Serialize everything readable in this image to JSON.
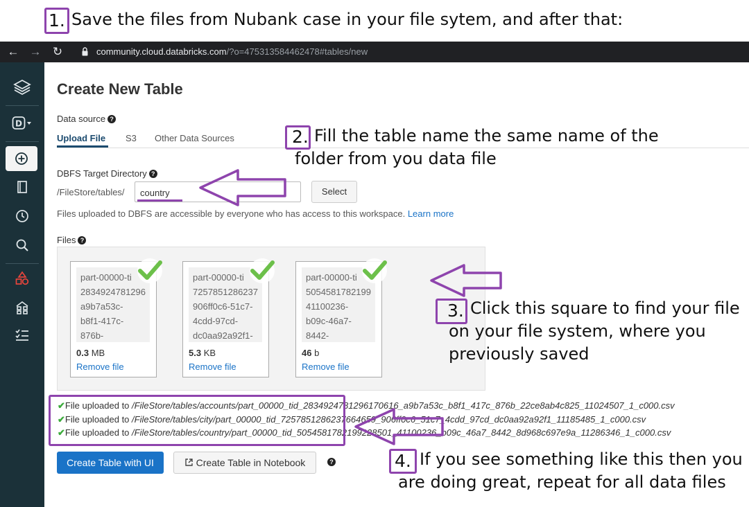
{
  "annotations": {
    "step1": {
      "num": "1.",
      "text": "Save the files from Nubank case in your file sytem, and after that:"
    },
    "step2": {
      "num": "2.",
      "line1": "Fill the table name the same name of the",
      "line2": "folder from you data file"
    },
    "step3": {
      "num": "3.",
      "line1": "Click this square to find your file",
      "line2": "on your file system, where you",
      "line3": "previously saved"
    },
    "step4": {
      "num": "4.",
      "line1": "If you see something like this then you",
      "line2": "are doing great, repeat for all data files"
    },
    "color": "#8e44ad"
  },
  "browser": {
    "url_host": "community.cloud.databricks.com",
    "url_rest": "/?o=475313584462478#tables/new"
  },
  "page": {
    "title": "Create New Table",
    "data_source_label": "Data source",
    "tabs": [
      "Upload File",
      "S3",
      "Other Data Sources"
    ],
    "dbfs_label": "DBFS Target Directory",
    "dbfs_prefix": "/FileStore/tables/",
    "dbfs_value": "country",
    "select_button": "Select",
    "access_note": "Files uploaded to DBFS are accessible by everyone who has access to this workspace.",
    "learn_more": "Learn more",
    "files_label": "Files"
  },
  "files": [
    {
      "lines": [
        "part-00000-ti",
        "2834924781296",
        "a9b7a53c-",
        "b8f1-417c-",
        "876b-"
      ],
      "size_num": "0.3",
      "size_unit": "MB",
      "remove": "Remove file"
    },
    {
      "lines": [
        "part-00000-ti",
        "7257851286237",
        "906ff0c6-51c7-",
        "4cdd-97cd-",
        "dc0aa92a92f1-"
      ],
      "size_num": "5.3",
      "size_unit": "KB",
      "remove": "Remove file"
    },
    {
      "lines": [
        "part-00000-ti",
        "5054581782199",
        "41100236-",
        "b09c-46a7-",
        "8442-"
      ],
      "size_num": "46",
      "size_unit": "b",
      "remove": "Remove file"
    }
  ],
  "uploaded": [
    {
      "prefix": "File uploaded to ",
      "path": "/FileStore/tables/accounts/part_00000_tid_2834924781296170616_a9b7a53c_b8f1_417c_876b_22ce8ab4c825_11024507_1_c000.csv"
    },
    {
      "prefix": "File uploaded to ",
      "path": "/FileStore/tables/city/part_00000_tid_7257851286237664659_906ff0c6_51c7_4cdd_97cd_dc0aa92a92f1_11185485_1_c000.csv"
    },
    {
      "prefix": "File uploaded to ",
      "path": "/FileStore/tables/country/part_00000_tid_5054581782199228501_41100236_b09c_46a7_8442_8d968c697e9a_11286346_1_c000.csv"
    }
  ],
  "buttons": {
    "create_ui": "Create Table with UI",
    "create_notebook": "Create Table in Notebook"
  },
  "icons": [
    "back-icon",
    "forward-icon",
    "reload-icon",
    "lock-icon",
    "databricks-logo-icon",
    "workspace-d-icon",
    "create-icon",
    "workspace-icon",
    "recents-icon",
    "search-icon",
    "data-icon",
    "clusters-icon",
    "jobs-icon",
    "check-icon",
    "external-link-icon",
    "help-icon"
  ]
}
